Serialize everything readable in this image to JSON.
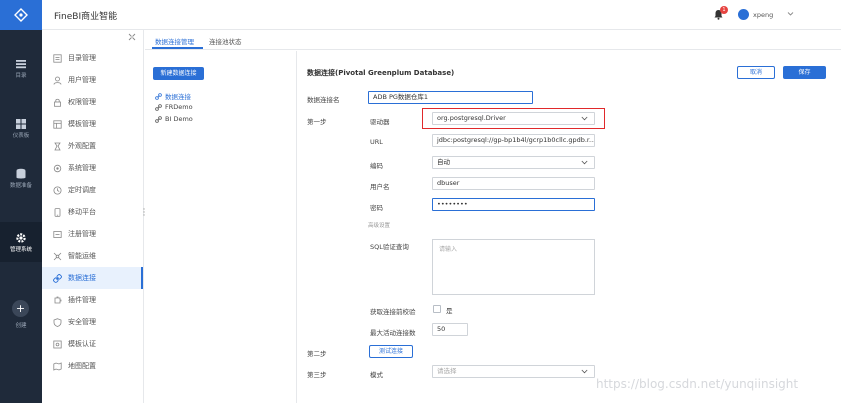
{
  "app": {
    "title": "FineBI商业智能"
  },
  "header": {
    "user_name": "xpeng",
    "notification_count": "1"
  },
  "rail": {
    "items": [
      {
        "label": "目录",
        "icon": "list-icon"
      },
      {
        "label": "仪表板",
        "icon": "dashboard-icon"
      },
      {
        "label": "数据准备",
        "icon": "database-icon"
      },
      {
        "label": "管理系统",
        "icon": "gear-icon",
        "active": true
      },
      {
        "label": "创建",
        "icon": "plus-icon"
      }
    ]
  },
  "sidebar": {
    "items": [
      {
        "label": "目录管理",
        "icon": "folder-icon"
      },
      {
        "label": "用户管理",
        "icon": "user-icon"
      },
      {
        "label": "权限管理",
        "icon": "lock-icon"
      },
      {
        "label": "模板管理",
        "icon": "template-icon"
      },
      {
        "label": "外观配置",
        "icon": "palette-icon"
      },
      {
        "label": "系统管理",
        "icon": "settings-icon"
      },
      {
        "label": "定时调度",
        "icon": "clock-icon"
      },
      {
        "label": "移动平台",
        "icon": "mobile-icon"
      },
      {
        "label": "注册管理",
        "icon": "register-icon"
      },
      {
        "label": "智能运维",
        "icon": "ops-icon"
      },
      {
        "label": "数据连接",
        "icon": "link-icon",
        "active": true
      },
      {
        "label": "插件管理",
        "icon": "plugin-icon"
      },
      {
        "label": "安全管理",
        "icon": "shield-icon"
      },
      {
        "label": "模板认证",
        "icon": "certificate-icon"
      },
      {
        "label": "地图配置",
        "icon": "map-icon"
      }
    ]
  },
  "tabs": [
    {
      "label": "数据连接管理",
      "active": true
    },
    {
      "label": "连接池状态"
    }
  ],
  "connections": {
    "new_button": "新建数据连接",
    "items": [
      {
        "label": "数据连接",
        "active": true
      },
      {
        "label": "FRDemo"
      },
      {
        "label": "BI Demo"
      }
    ]
  },
  "form": {
    "title": "数据连接(Pivotal Greenplum Database)",
    "cancel": "取消",
    "save": "保存",
    "name_label": "数据连接名",
    "name_value": "ADB PG数据仓库1",
    "step1": "第一步",
    "driver_label": "驱动器",
    "driver_value": "org.postgresql.Driver",
    "url_label": "URL",
    "url_value": "jdbc:postgresql://gp-bp1b4l/gcrp1b0cllc.gpdb.r...",
    "encoding_label": "编码",
    "encoding_value": "自动",
    "username_label": "用户名",
    "username_value": "dbuser",
    "password_label": "密码",
    "password_value": "••••••••",
    "advanced_label": "高级设置",
    "sql_label": "SQL验证查询",
    "sql_placeholder": "请输入",
    "validate_label": "获取连接前校验",
    "validate_option": "是",
    "max_active_label": "最大活动连接数",
    "max_active_value": "50",
    "step2": "第二步",
    "test_button": "测试连接",
    "step3": "第三步",
    "schema_label": "模式",
    "schema_placeholder": "请选择"
  },
  "watermark": "https://blog.csdn.net/yunqiinsight",
  "colors": {
    "accent": "#2a6fd6",
    "rail": "#1f2a3a",
    "highlight": "#e0292b"
  }
}
